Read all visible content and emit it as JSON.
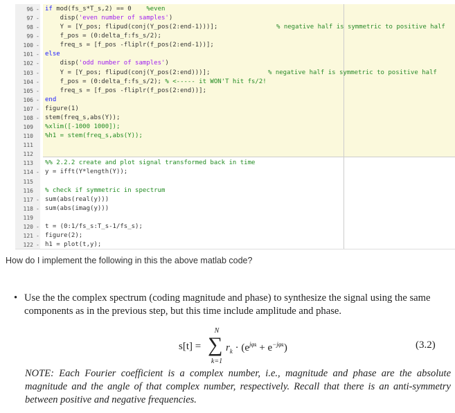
{
  "code": {
    "lines": [
      {
        "n": "96",
        "d": "-",
        "segs": [
          {
            "t": "kw",
            "v": "if"
          },
          {
            "t": "pl",
            "v": " mod(fs_s*T_s,2) == 0    "
          },
          {
            "t": "cm",
            "v": "%even"
          }
        ]
      },
      {
        "n": "97",
        "d": "-",
        "segs": [
          {
            "t": "pl",
            "v": "    disp("
          },
          {
            "t": "str",
            "v": "'even number of samples'"
          },
          {
            "t": "pl",
            "v": ")"
          }
        ]
      },
      {
        "n": "98",
        "d": "-",
        "segs": [
          {
            "t": "pl",
            "v": "    Y = [Y_pos; flipud(conj(Y_pos(2:end-1)))];"
          }
        ],
        "comment": "% negative half is symmetric to positive half",
        "cpos": "a"
      },
      {
        "n": "99",
        "d": "-",
        "segs": [
          {
            "t": "pl",
            "v": "    f_pos = (0:delta_f:fs_s/2);"
          }
        ]
      },
      {
        "n": "100",
        "d": "-",
        "segs": [
          {
            "t": "pl",
            "v": "    freq_s = [f_pos -fliplr(f_pos(2:end-1))];"
          }
        ]
      },
      {
        "n": "101",
        "d": "-",
        "segs": [
          {
            "t": "kw",
            "v": "else"
          }
        ]
      },
      {
        "n": "102",
        "d": "-",
        "segs": [
          {
            "t": "pl",
            "v": "    disp("
          },
          {
            "t": "str",
            "v": "'odd number of samples'"
          },
          {
            "t": "pl",
            "v": ")"
          }
        ]
      },
      {
        "n": "103",
        "d": "-",
        "segs": [
          {
            "t": "pl",
            "v": "    Y = [Y_pos; flipud(conj(Y_pos(2:end)))];"
          }
        ],
        "comment": "% negative half is symmetric to positive half",
        "cpos": "b"
      },
      {
        "n": "104",
        "d": "-",
        "segs": [
          {
            "t": "pl",
            "v": "    f_pos = (0:delta_f:fs_s/2); "
          },
          {
            "t": "cm",
            "v": "% <----- it WON'T hit fs/2!"
          }
        ]
      },
      {
        "n": "105",
        "d": "-",
        "segs": [
          {
            "t": "pl",
            "v": "    freq_s = [f_pos -fliplr(f_pos(2:end))];"
          }
        ]
      },
      {
        "n": "106",
        "d": "-",
        "segs": [
          {
            "t": "kw",
            "v": "end"
          }
        ]
      },
      {
        "n": "107",
        "d": "-",
        "segs": [
          {
            "t": "pl",
            "v": "figure(1)"
          }
        ]
      },
      {
        "n": "108",
        "d": "-",
        "segs": [
          {
            "t": "pl",
            "v": "stem(freq_s,abs(Y));"
          }
        ]
      },
      {
        "n": "109",
        "d": "",
        "segs": [
          {
            "t": "cm",
            "v": "%xlim([-1000 1000]);"
          }
        ]
      },
      {
        "n": "110",
        "d": "",
        "segs": [
          {
            "t": "cm",
            "v": "%h1 = stem(freq_s,abs(Y));"
          }
        ]
      },
      {
        "n": "111",
        "d": "",
        "segs": []
      },
      {
        "n": "112",
        "d": "",
        "segs": []
      },
      {
        "n": "113",
        "d": "",
        "segs": [
          {
            "t": "cm",
            "v": "%% 2.2.2 create and plot signal transformed back in time"
          }
        ]
      },
      {
        "n": "114",
        "d": "-",
        "segs": [
          {
            "t": "pl",
            "v": "y = ifft(Y*length(Y));"
          }
        ]
      },
      {
        "n": "115",
        "d": "",
        "segs": []
      },
      {
        "n": "116",
        "d": "",
        "segs": [
          {
            "t": "cm",
            "v": "% check if symmetric in spectrum"
          }
        ]
      },
      {
        "n": "117",
        "d": "-",
        "segs": [
          {
            "t": "pl",
            "v": "sum(abs(real(y)))"
          }
        ]
      },
      {
        "n": "118",
        "d": "-",
        "segs": [
          {
            "t": "pl",
            "v": "sum(abs(imag(y)))"
          }
        ]
      },
      {
        "n": "119",
        "d": "",
        "segs": []
      },
      {
        "n": "120",
        "d": "-",
        "segs": [
          {
            "t": "pl",
            "v": "t = (0:1/fs_s:T_s-1/fs_s);"
          }
        ]
      },
      {
        "n": "121",
        "d": "-",
        "segs": [
          {
            "t": "pl",
            "v": "figure(2);"
          }
        ]
      },
      {
        "n": "122",
        "d": "-",
        "segs": [
          {
            "t": "pl",
            "v": "h1 = plot(t,y);"
          }
        ]
      }
    ]
  },
  "question": "How do I implement the following in this the above matlab code?",
  "bullet": "Use the the complex spectrum (coding magnitude and phase) to synthesize the signal using the same components as in the previous step, but this time include amplitude and phase.",
  "equation": {
    "lhs": "s[t] = ",
    "upper": "N",
    "lower": "k=1",
    "sum": "∑",
    "body_r": "r",
    "body_k": "k",
    "dot": " · (e",
    "exp1": "jφ",
    "sub1": "k",
    "plus": " + e",
    "exp2": "−jφ",
    "sub2": "k",
    "close": ")",
    "number": "(3.2)"
  },
  "note": "NOTE: Each Fourier coefficient is a complex number, i.e., magnitude and phase are the absolute magnitude and the angle of that complex number, respectively. Recall that there is an anti-symmetry between positive and negative frequencies."
}
